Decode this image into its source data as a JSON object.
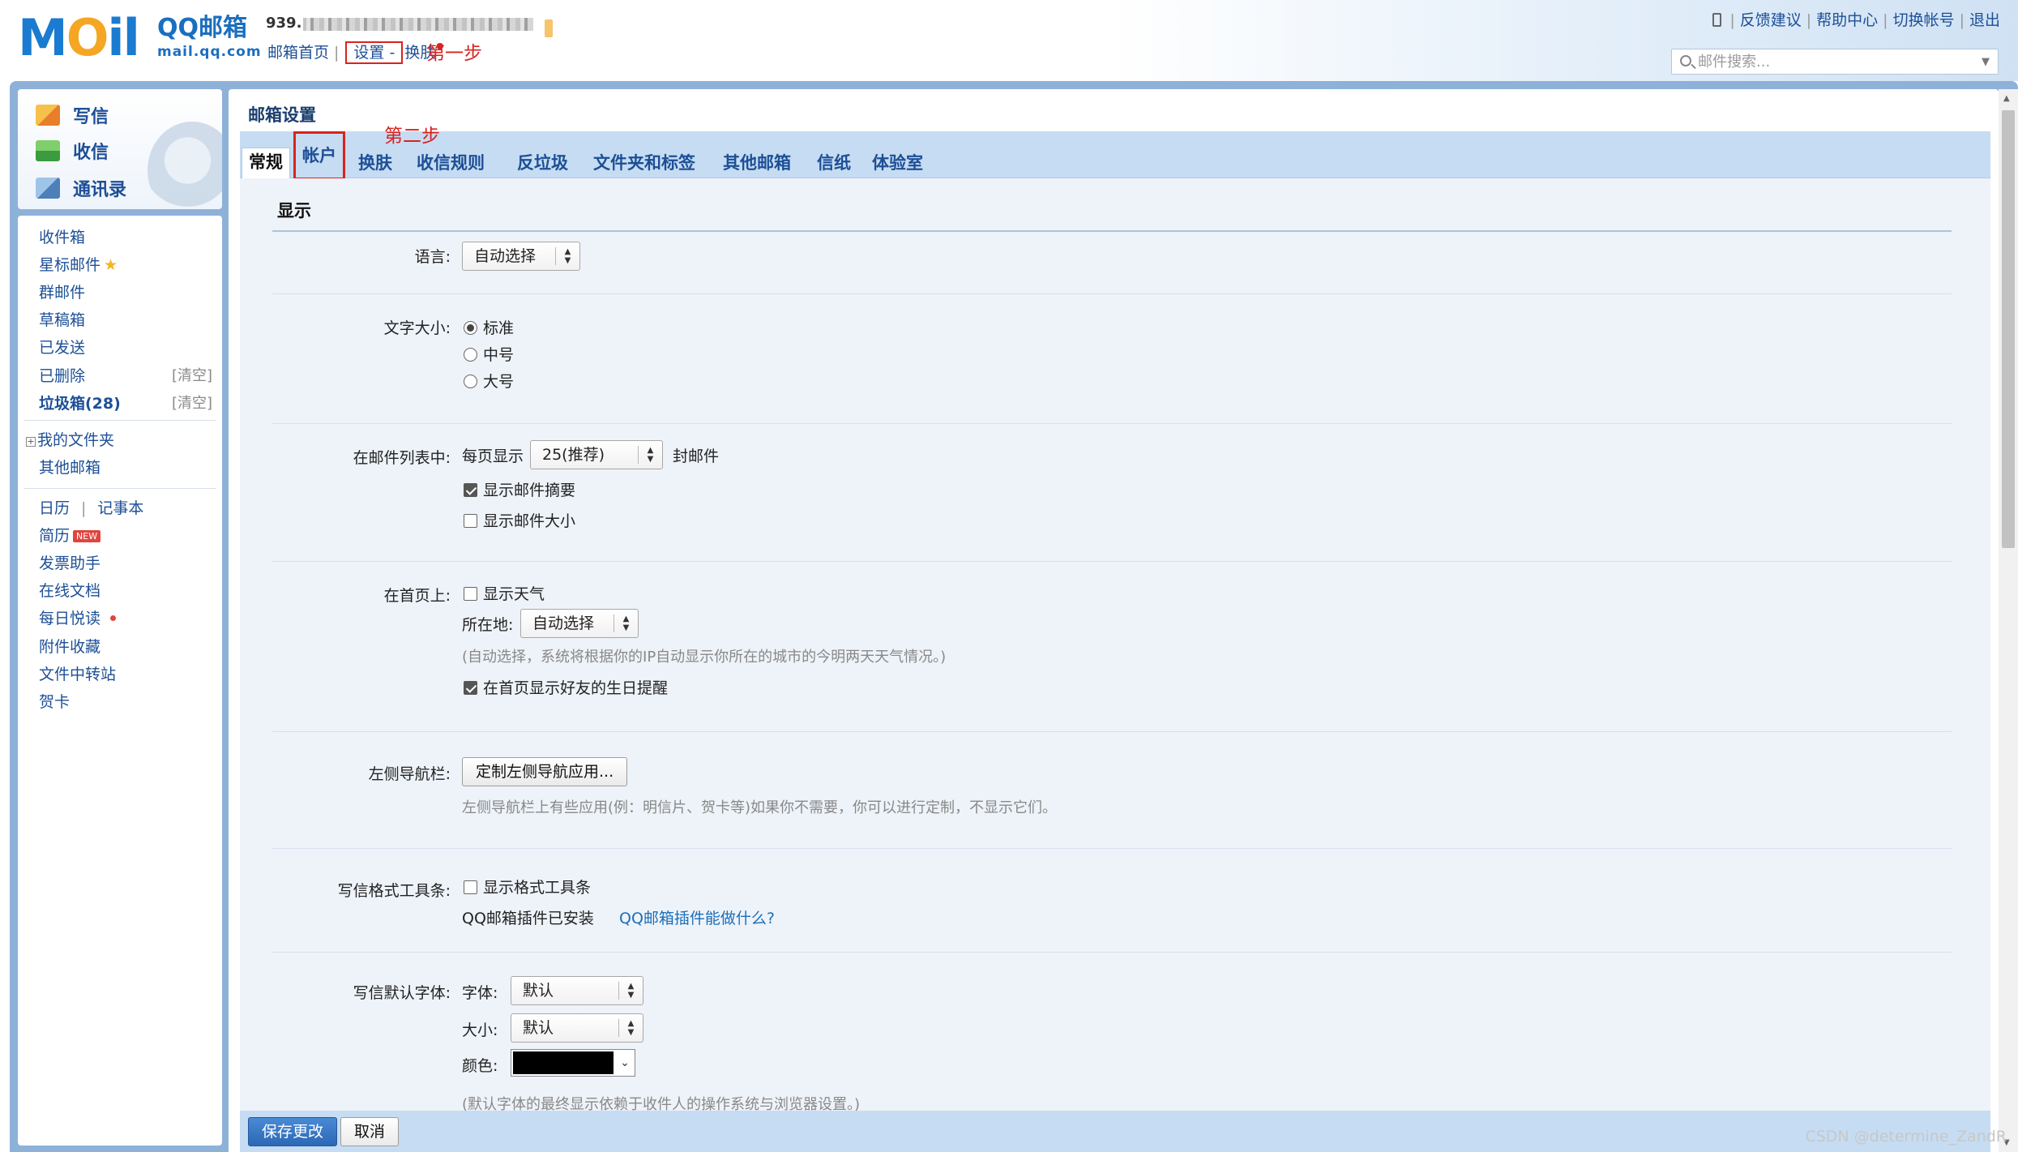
{
  "header": {
    "logo_text": "MOil",
    "logo_brand": "QQ邮箱",
    "logo_url": "mail.qq.com",
    "account_prefix": "939.",
    "top_links": {
      "home": "邮箱首页",
      "settings": "设置",
      "skin": "换肤",
      "separator": "|",
      "settings_arrow": "-"
    },
    "annotation_step1": "第一步",
    "right_links": [
      "反馈建议",
      "帮助中心",
      "切换帐号",
      "退出"
    ],
    "right_sep": "|",
    "search_placeholder": "邮件搜索...",
    "search_arrow": "▼"
  },
  "sidebar": {
    "quick_actions": [
      {
        "label": "写信",
        "icon": "write-icon"
      },
      {
        "label": "收信",
        "icon": "inbox-download-icon"
      },
      {
        "label": "通讯录",
        "icon": "contacts-icon"
      }
    ],
    "folders": [
      {
        "label": "收件箱"
      },
      {
        "label": "星标邮件",
        "icon": "star-icon"
      },
      {
        "label": "群邮件"
      },
      {
        "label": "草稿箱"
      },
      {
        "label": "已发送"
      },
      {
        "label": "已删除",
        "action": "[清空]"
      },
      {
        "label": "垃圾箱(28)",
        "action": "[清空]",
        "bold": true
      }
    ],
    "my_folders": "我的文件夹",
    "expand_glyph": "+",
    "other_mailbox": "其他邮箱",
    "apps": {
      "calendar": "日历",
      "notes": "记事本",
      "sep": "|",
      "resume": "简历",
      "new_badge": "NEW",
      "invoice": "发票助手",
      "online_docs": "在线文档",
      "daily_reading": "每日悦读",
      "attachments": "附件收藏",
      "file_transfer": "文件中转站",
      "greeting_card": "贺卡"
    },
    "star_glyph": "★"
  },
  "main": {
    "title": "邮箱设置",
    "annotation_step2": "第二步",
    "tabs": [
      "常规",
      "帐户",
      "换肤",
      "收信规则",
      "反垃圾",
      "文件夹和标签",
      "其他邮箱",
      "信纸",
      "体验室"
    ],
    "active_tab": "常规",
    "section_title": "显示",
    "language": {
      "label": "语言:",
      "value": "自动选择"
    },
    "font_size": {
      "label": "文字大小:",
      "options": [
        "标准",
        "中号",
        "大号"
      ],
      "selected": "标准"
    },
    "mail_list": {
      "label": "在邮件列表中:",
      "per_page_prefix": "每页显示",
      "per_page_value": "25(推荐)",
      "per_page_suffix": "封邮件",
      "show_summary": "显示邮件摘要",
      "show_summary_checked": true,
      "show_size": "显示邮件大小",
      "show_size_checked": false
    },
    "homepage": {
      "label": "在首页上:",
      "show_weather": "显示天气",
      "show_weather_checked": false,
      "location_label": "所在地:",
      "location_value": "自动选择",
      "weather_hint": "(自动选择，系统将根据你的IP自动显示你所在的城市的今明两天天气情况。)",
      "birthday": "在首页显示好友的生日提醒",
      "birthday_checked": true
    },
    "left_nav": {
      "label": "左侧导航栏:",
      "button": "定制左侧导航应用...",
      "hint": "左侧导航栏上有些应用(例：明信片、贺卡等)如果你不需要，你可以进行定制，不显示它们。"
    },
    "format_toolbar": {
      "label": "写信格式工具条:",
      "show_toolbar": "显示格式工具条",
      "show_toolbar_checked": false,
      "plugin_installed": "QQ邮箱插件已安装",
      "plugin_link": "QQ邮箱插件能做什么?"
    },
    "default_font": {
      "label": "写信默认字体:",
      "font_label": "字体:",
      "font_value": "默认",
      "size_label": "大小:",
      "size_value": "默认",
      "color_label": "颜色:",
      "color_value": "#000000",
      "hint": "(默认字体的最终显示依赖于收件人的操作系统与浏览器设置。)"
    },
    "footer": {
      "save": "保存更改",
      "cancel": "取消"
    },
    "select_arrows": "▲▼"
  },
  "watermark": "CSDN @determine_ZandR",
  "colors": {
    "accent": "#1d4f96",
    "annotation_red": "#d9231f",
    "frame_blue": "#8eb1d8",
    "tab_bar": "#c6dcf2",
    "content_bg": "#eef3f9"
  }
}
